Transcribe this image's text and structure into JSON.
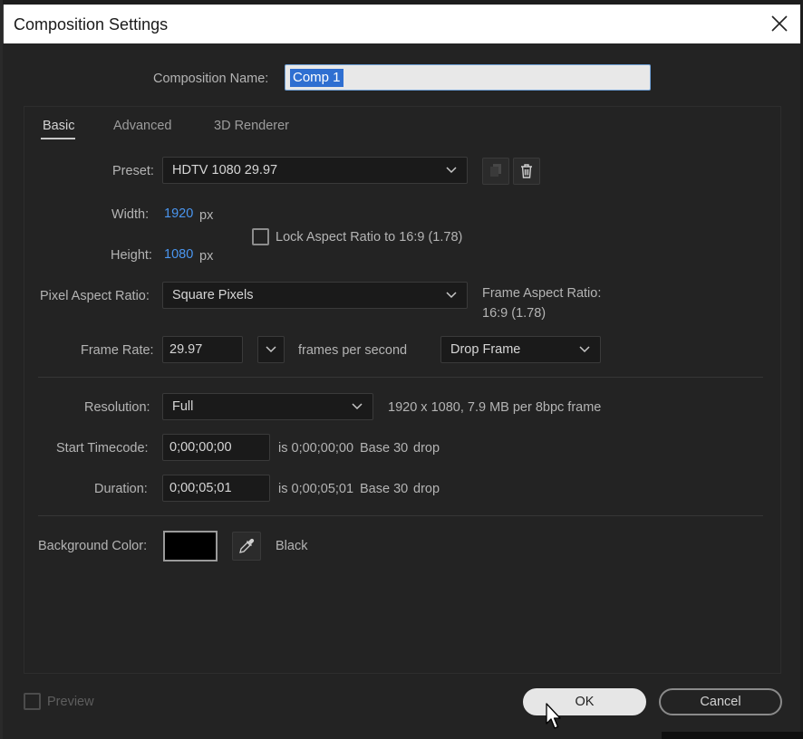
{
  "window": {
    "title": "Composition Settings"
  },
  "composition_name": {
    "label": "Composition Name:",
    "value": "Comp 1"
  },
  "tabs": [
    {
      "label": "Basic",
      "active": true
    },
    {
      "label": "Advanced",
      "active": false
    },
    {
      "label": "3D Renderer",
      "active": false
    }
  ],
  "preset": {
    "label": "Preset:",
    "value": "HDTV 1080 29.97"
  },
  "width": {
    "label": "Width:",
    "value": "1920",
    "unit": "px"
  },
  "height": {
    "label": "Height:",
    "value": "1080",
    "unit": "px"
  },
  "lock_aspect": {
    "label": "Lock Aspect Ratio to 16:9 (1.78)",
    "checked": false
  },
  "pixel_aspect": {
    "label": "Pixel Aspect Ratio:",
    "value": "Square Pixels"
  },
  "frame_aspect": {
    "label": "Frame Aspect Ratio:",
    "value": "16:9 (1.78)"
  },
  "frame_rate": {
    "label": "Frame Rate:",
    "value": "29.97",
    "unit_label": "frames per second",
    "drop_frame": "Drop Frame"
  },
  "resolution": {
    "label": "Resolution:",
    "value": "Full",
    "info": "1920 x 1080, 7.9 MB per 8bpc frame"
  },
  "start_timecode": {
    "label": "Start Timecode:",
    "value": "0;00;00;00",
    "info_is": "is 0;00;00;00",
    "info_base": "Base 30",
    "info_drop": "drop"
  },
  "duration": {
    "label": "Duration:",
    "value": "0;00;05;01",
    "info_is": "is 0;00;05;01",
    "info_base": "Base 30",
    "info_drop": "drop"
  },
  "background": {
    "label": "Background Color:",
    "color_name": "Black",
    "color": "#000000"
  },
  "footer": {
    "preview_label": "Preview",
    "preview_checked": false,
    "ok_label": "OK",
    "cancel_label": "Cancel"
  },
  "colors": {
    "accent_blue": "#4a96f0",
    "selection": "#2f6fd1",
    "dialog_bg": "#232323"
  }
}
